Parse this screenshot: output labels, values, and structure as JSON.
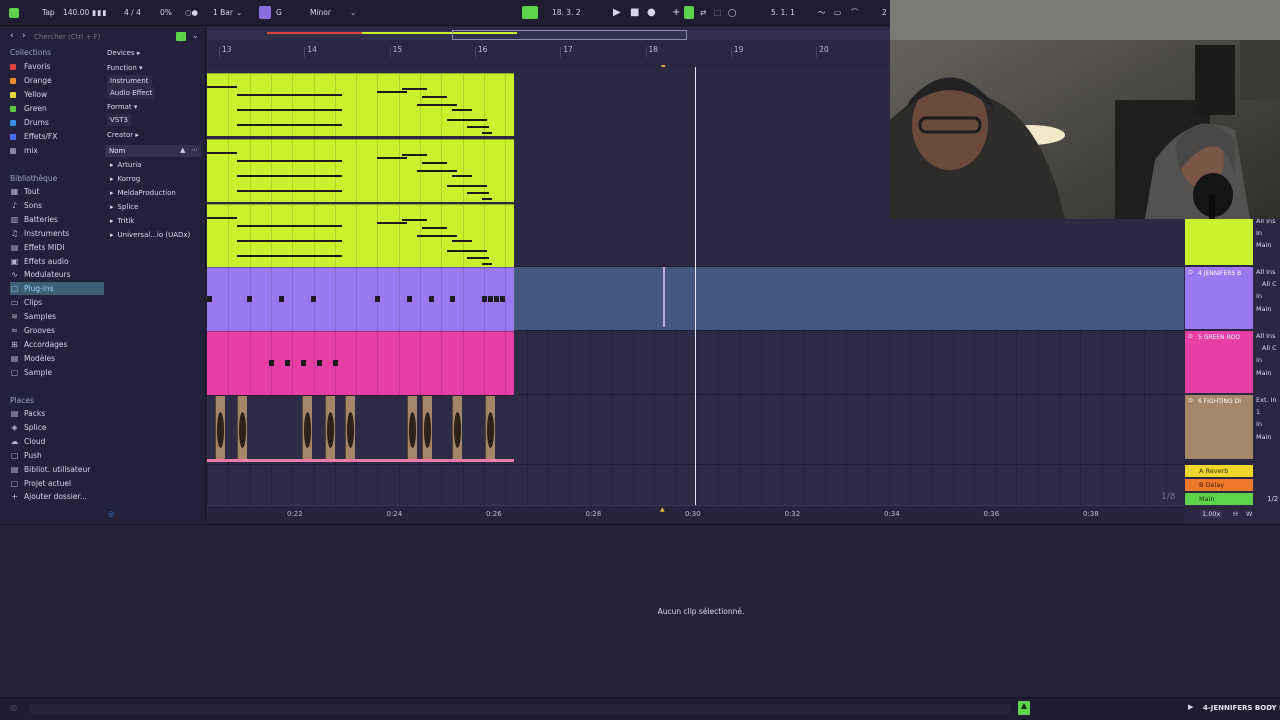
{
  "topbar": {
    "tap": "Tap",
    "tempo": "140.00",
    "time_sig": "4 / 4",
    "cpu": "0%",
    "quantize": "1 Bar",
    "key": "G",
    "scale": "Minor",
    "position": "18.  3.  2",
    "loop_start": "5.  1.  1",
    "right_num": "2"
  },
  "browser": {
    "search_placeholder": "Chercher (Ctrl + F)",
    "collections_title": "Collections",
    "collections": [
      {
        "label": "Favoris",
        "color": "#e0453d"
      },
      {
        "label": "Orange",
        "color": "#f08a2c"
      },
      {
        "label": "Yellow",
        "color": "#e8d53a"
      },
      {
        "label": "Green",
        "color": "#5ec844"
      },
      {
        "label": "Drums",
        "color": "#3a8fe0"
      },
      {
        "label": "Effets/FX",
        "color": "#4a6ef0"
      },
      {
        "label": "mix",
        "color": "#8a86a6"
      }
    ],
    "library_title": "Bibliothèque",
    "library": [
      {
        "label": "Tout",
        "icon": "grid-icon"
      },
      {
        "label": "Sons",
        "icon": "sound-icon"
      },
      {
        "label": "Batteries",
        "icon": "drums-icon"
      },
      {
        "label": "Instruments",
        "icon": "instrument-icon"
      },
      {
        "label": "Effets MIDI",
        "icon": "midi-effect-icon"
      },
      {
        "label": "Effets audio",
        "icon": "audio-effect-icon"
      },
      {
        "label": "Modulateurs",
        "icon": "modulator-icon"
      },
      {
        "label": "Plug-ins",
        "icon": "plugin-icon"
      },
      {
        "label": "Clips",
        "icon": "clip-icon"
      },
      {
        "label": "Samples",
        "icon": "sample-icon"
      },
      {
        "label": "Grooves",
        "icon": "groove-icon"
      },
      {
        "label": "Accordages",
        "icon": "tuning-icon"
      },
      {
        "label": "Modèles",
        "icon": "template-icon"
      },
      {
        "label": "Sample",
        "icon": "folder-icon"
      }
    ],
    "places_title": "Places",
    "places": [
      {
        "label": "Packs",
        "icon": "pack-icon"
      },
      {
        "label": "Splice",
        "icon": "splice-icon"
      },
      {
        "label": "Cloud",
        "icon": "cloud-icon"
      },
      {
        "label": "Push",
        "icon": "push-icon"
      },
      {
        "label": "Bibliot. utilisateur",
        "icon": "user-library-icon"
      },
      {
        "label": "Projet actuel",
        "icon": "project-icon"
      },
      {
        "label": "Ajouter dossier...",
        "icon": "add-folder-icon"
      }
    ],
    "filters": {
      "devices": "Devices",
      "function": "Function",
      "instrument": "Instrument",
      "audio_effect": "Audio Effect",
      "format": "Format",
      "vst3": "VST3",
      "creator": "Creator"
    },
    "results_header": "Nom",
    "results": [
      "Arturia",
      "Korrog",
      "MeldaProduction",
      "Splice",
      "Tritik",
      "Universal...io (UADx)"
    ]
  },
  "ruler": {
    "bars": [
      "13",
      "14",
      "15",
      "16",
      "17",
      "18",
      "19",
      "20"
    ]
  },
  "timeline": {
    "labels": [
      "0:22",
      "0:24",
      "0:26",
      "0:28",
      "0:30",
      "0:32",
      "0:34",
      "0:36",
      "0:38"
    ]
  },
  "tracks": {
    "t4_name": "4 JENNIFERS B",
    "t5_name": "5 GREEN ROO",
    "t6_name": "6 FIGHTING DI",
    "all_ins": "All Ins",
    "all_ch": "All C",
    "in": "In",
    "main": "Main",
    "ext_in": "Ext. In",
    "one": "1",
    "return_a": "A Reverb",
    "return_b": "B Delay",
    "main_track": "Main",
    "page": "1/8",
    "ratio": "1/2",
    "zoom": "1.00x",
    "h": "H",
    "w": "W"
  },
  "detail": {
    "no_clip": "Aucun clip sélectionné."
  },
  "status": {
    "track_name": "4-JENNIFERS BODY Se"
  },
  "colors": {
    "lime": "#c9f12e",
    "purple": "#9a78ef",
    "pink": "#e83fa6",
    "tan": "#a58668",
    "accent_green": "#5ed44a"
  }
}
